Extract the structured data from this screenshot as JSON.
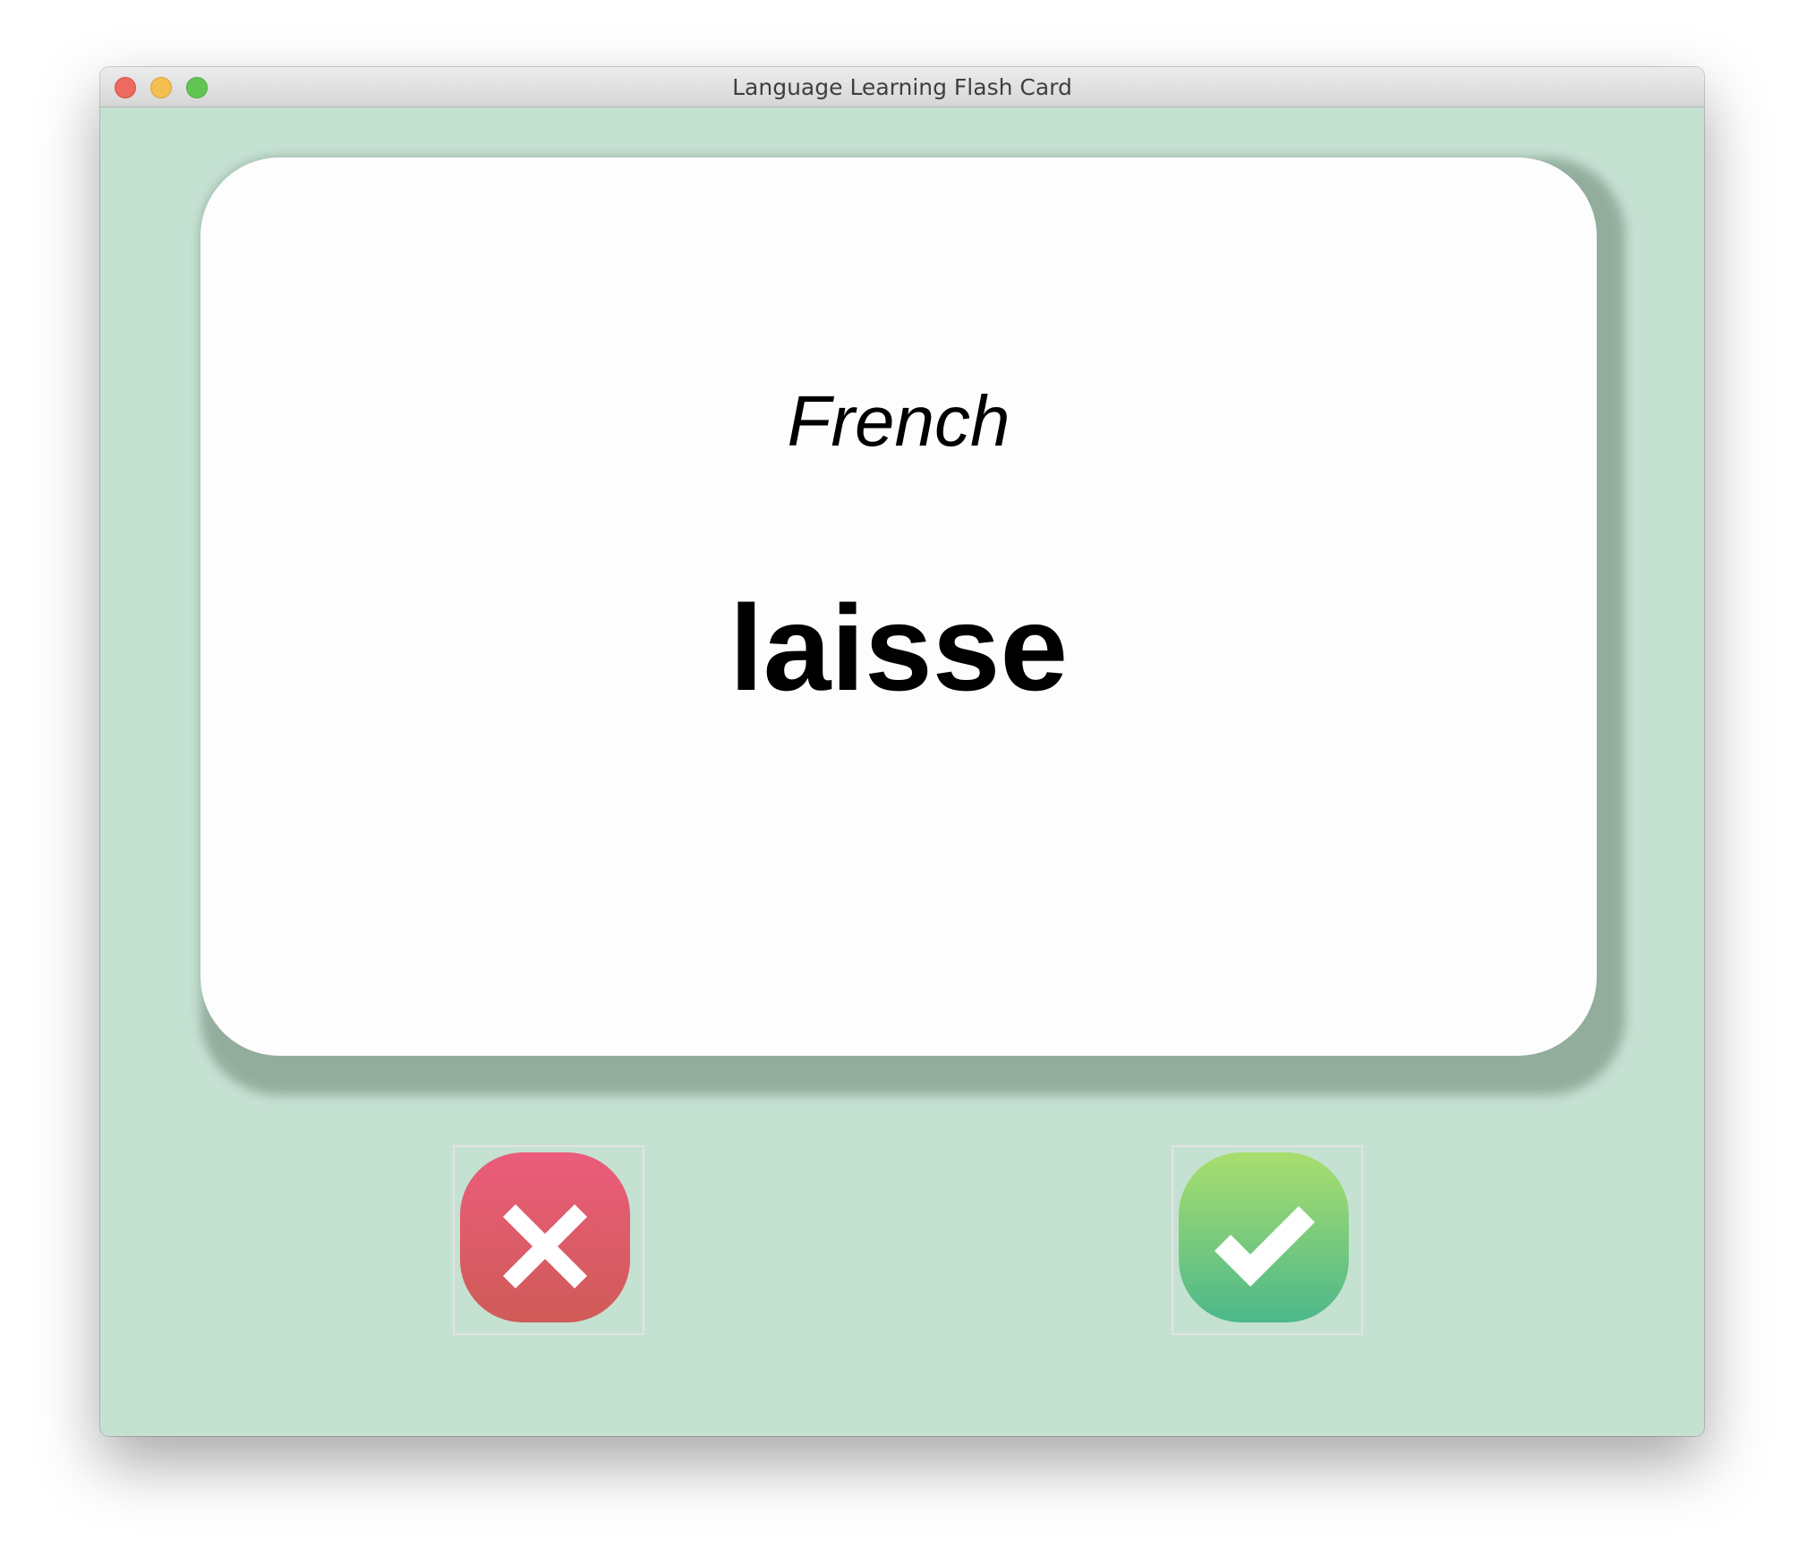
{
  "window": {
    "title": "Language Learning Flash Card"
  },
  "card": {
    "language": "French",
    "word": "laisse"
  },
  "buttons": {
    "wrong_icon": "cross-icon",
    "right_icon": "checkmark-icon"
  },
  "colors": {
    "background": "#c5e1d2",
    "card": "#fdfdfd",
    "wrong_button": "#e05a6f",
    "right_button": "#7fce7a"
  }
}
